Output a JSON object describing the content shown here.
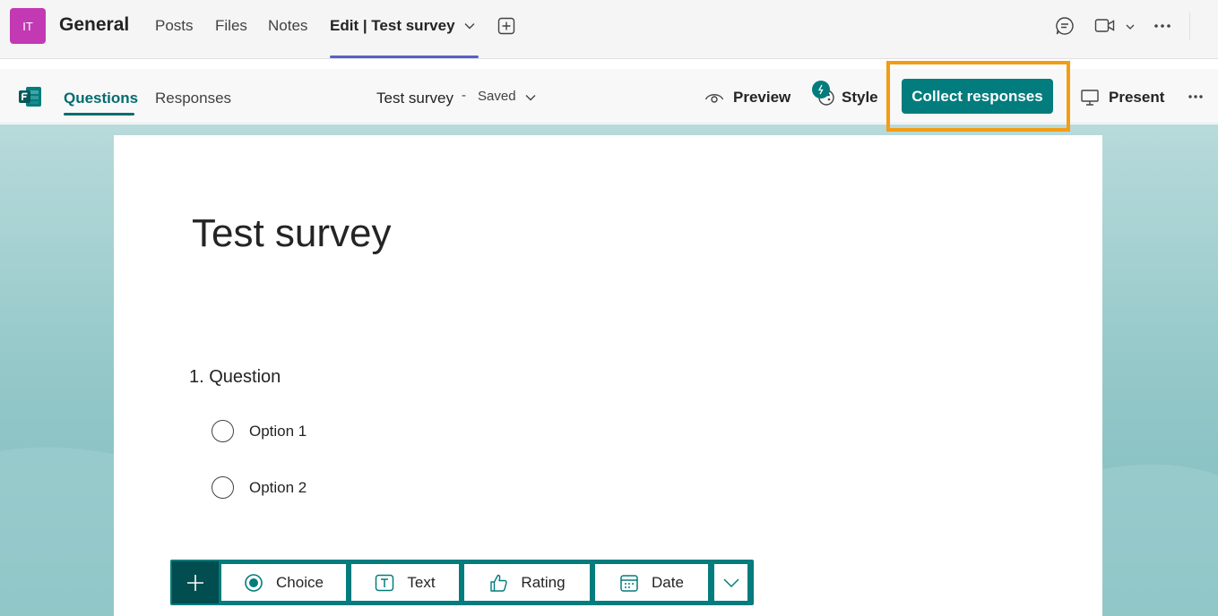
{
  "teams_header": {
    "team_initials": "IT",
    "channel": "General",
    "tabs": [
      {
        "label": "Posts"
      },
      {
        "label": "Files"
      },
      {
        "label": "Notes"
      },
      {
        "label": "Edit | Test survey",
        "active": true
      }
    ]
  },
  "forms_toolbar": {
    "tabs": [
      {
        "label": "Questions",
        "active": true
      },
      {
        "label": "Responses"
      }
    ],
    "survey_title": "Test survey",
    "separator": "-",
    "save_status": "Saved",
    "preview_label": "Preview",
    "style_label": "Style",
    "collect_label": "Collect responses",
    "present_label": "Present"
  },
  "form": {
    "title": "Test survey",
    "questions": [
      {
        "label": "1. Question",
        "options": [
          "Option 1",
          "Option 2"
        ]
      }
    ]
  },
  "add_question_bar": {
    "types": [
      "Choice",
      "Text",
      "Rating",
      "Date"
    ]
  },
  "colors": {
    "accent": "#037c7d",
    "teams_purple": "#5b5fc7",
    "highlight": "#f29d14",
    "avatar": "#c239b3"
  }
}
